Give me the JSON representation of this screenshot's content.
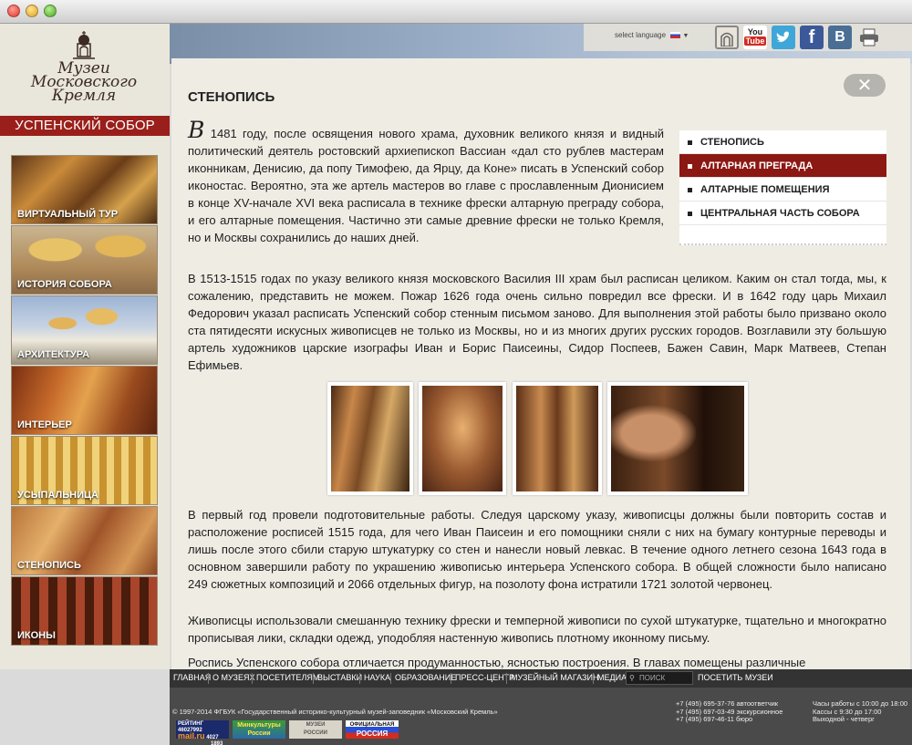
{
  "sidebar": {
    "logo_lines": [
      "Музеи",
      "Московского",
      "Кремля"
    ],
    "section_title": "УСПЕНСКИЙ СОБОР",
    "items": [
      {
        "label": "ВИРТУАЛЬНЫЙ ТУР"
      },
      {
        "label": "ИСТОРИЯ СОБОРА"
      },
      {
        "label": "АРХИТЕКТУРА"
      },
      {
        "label": "ИНТЕРЬЕР"
      },
      {
        "label": "УСЫПАЛЬНИЦА"
      },
      {
        "label": "СТЕНОПИСЬ"
      },
      {
        "label": "ИКОНЫ"
      }
    ]
  },
  "header": {
    "select_language": "select language",
    "social": {
      "youtube_top": "You",
      "youtube_bottom": "Tube",
      "facebook": "f",
      "vk": "B"
    }
  },
  "main": {
    "title": "СТЕНОПИСЬ",
    "close_label": "✕",
    "p1_dropcap": "В",
    "p1": " 1481 году, после освящения нового храма, духовник великого князя и видный политический деятель ростовский архиепископ Вассиан «дал сто рублев мастерам иконникам, Денисию, да попу Тимофею, да Ярцу, да Коне» писать в Успенский собор иконостас. Вероятно, эта же артель мастеров во главе с прославленным Дионисием в конце XV-начале XVI века расписала в технике фрески алтарную преграду собора, и его алтарные помещения. Частично эти самые древние фрески не только Кремля, но и Москвы сохранились до наших дней.",
    "p2": "В 1513-1515 годах по указу великого князя московского Василия III храм был расписан целиком. Каким он стал тогда, мы, к сожалению, представить не можем. Пожар 1626 года очень сильно повредил все фрески. И в 1642 году царь Михаил Федорович указал расписать Успенский собор стенным письмом заново. Для выполнения этой работы было призвано около ста пятидесяти искусных живописцев не только из Москвы, но и из многих других русских городов. Возглавили эту большую артель художников царские изографы Иван и Борис Паисеины, Сидор Поспеев, Бажен Савин, Марк Матвеев, Степан Ефимьев.",
    "p3": "В первый год провели подготовительные работы. Следуя царскому указу, живописцы должны были повторить состав и расположение росписей 1515 года, для чего Иван Паисеин и его помощники сняли с них на бумагу контурные переводы и лишь после этого сбили старую штукатурку со стен и нанесли новый левкас. В течение одного летнего сезона 1643 года в основном завершили работу по украшению живописью интерьера Успенского собора. В общей сложности было написано 249 сюжетных композиций и 2066 отдельных фигур, на позолоту фона истратили 1721 золотой червонец.",
    "p4": "Живописцы использовали смешанную технику фрески и темперной живописи по сухой штукатурке, тщательно и многократно прописывая лики, складки одежд, уподобляя настенную живопись плотному иконному письму.",
    "p5": "Роспись Успенского собора отличается продуманностью, ясностью построения. В главах помещены различные"
  },
  "submenu": {
    "items": [
      {
        "label": "СТЕНОПИСЬ",
        "active": false
      },
      {
        "label": "АЛТАРНАЯ ПРЕГРАДА",
        "active": true
      },
      {
        "label": "АЛТАРНЫЕ ПОМЕЩЕНИЯ",
        "active": false
      },
      {
        "label": "ЦЕНТРАЛЬНАЯ ЧАСТЬ СОБОРА",
        "active": false
      }
    ]
  },
  "footer": {
    "nav": [
      "ГЛАВНАЯ",
      "О МУЗЕЯХ",
      "ПОСЕТИТЕЛЯМ",
      "ВЫСТАВКИ",
      "НАУКА",
      "ОБРАЗОВАНИЕ",
      "ПРЕСС-ЦЕНТР",
      "МУЗЕЙНЫЙ МАГАЗИН",
      "МЕДИА"
    ],
    "search_placeholder": "ПОИСК",
    "visit": "ПОСЕТИТЬ МУЗЕИ",
    "copyright": "© 1997-2014 ФГБУК «Государственный историко-культурный музей-заповедник «Московский Кремль»",
    "phones": [
      "+7 (495) 695-37-76 автоответчик",
      "+7 (495) 697-03-49 экскурсионное",
      "+7 (495) 697-46-11 бюро"
    ],
    "hours": [
      "Часы работы с 10:00 до 18:00",
      "Кассы с 9:30 до 17:00",
      "Выходной - четверг"
    ],
    "counter": {
      "name": "mail.ru",
      "rating": "РЕЙТИНГ",
      "n1": "46027992",
      "n2": "4027",
      "n3": "1893"
    },
    "badges": {
      "mincult": "Минкультуры",
      "mincult2": "России",
      "muzei": "МУЗЕИ",
      "muzei2": "РОССИИ",
      "official": "ОФИЦИАЛЬНАЯ",
      "russia": "РОССИЯ"
    }
  },
  "colors": {
    "accent_red": "#9a1f1a",
    "submenu_active": "#8c1813",
    "footer_bg": "#333333"
  }
}
